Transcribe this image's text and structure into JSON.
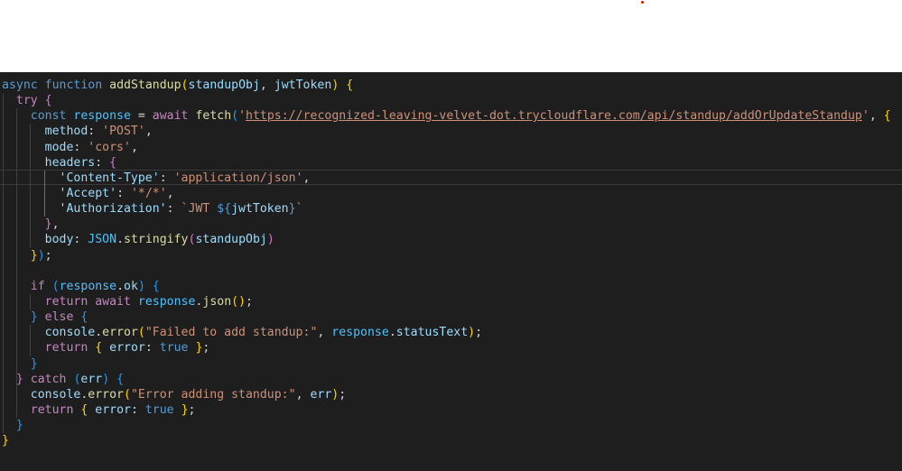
{
  "colors": {
    "editor_bg": "#1e1e1e",
    "page_bg": "#ffffff",
    "indent_guide": "#404040",
    "active_guide": "#707070",
    "marker": "#e51400"
  },
  "code": {
    "lines": [
      [
        {
          "t": "async",
          "c": "kw"
        },
        {
          "t": " "
        },
        {
          "t": "function",
          "c": "kw"
        },
        {
          "t": " "
        },
        {
          "t": "addStandup",
          "c": "fn"
        },
        {
          "t": "(",
          "c": "b1"
        },
        {
          "t": "standupObj",
          "c": "var"
        },
        {
          "t": ", "
        },
        {
          "t": "jwtToken",
          "c": "var"
        },
        {
          "t": ")",
          "c": "b1"
        },
        {
          "t": " "
        },
        {
          "t": "{",
          "c": "b1"
        }
      ],
      [
        {
          "t": "  "
        },
        {
          "t": "try",
          "c": "ctrl"
        },
        {
          "t": " "
        },
        {
          "t": "{",
          "c": "b2"
        }
      ],
      [
        {
          "t": "    "
        },
        {
          "t": "const",
          "c": "kw"
        },
        {
          "t": " "
        },
        {
          "t": "response",
          "c": "const"
        },
        {
          "t": " = "
        },
        {
          "t": "await",
          "c": "ctrl"
        },
        {
          "t": " "
        },
        {
          "t": "fetch",
          "c": "fn"
        },
        {
          "t": "(",
          "c": "b3"
        },
        {
          "t": "'",
          "c": "str"
        },
        {
          "t": "https://recognized-leaving-velvet-dot.trycloudflare.com/api/standup/addOrUpdateStandup",
          "c": "url"
        },
        {
          "t": "'",
          "c": "str"
        },
        {
          "t": ", "
        },
        {
          "t": "{",
          "c": "b1"
        }
      ],
      [
        {
          "t": "      "
        },
        {
          "t": "method",
          "c": "var"
        },
        {
          "t": ": "
        },
        {
          "t": "'POST'",
          "c": "str"
        },
        {
          "t": ","
        }
      ],
      [
        {
          "t": "      "
        },
        {
          "t": "mode",
          "c": "var"
        },
        {
          "t": ": "
        },
        {
          "t": "'cors'",
          "c": "str"
        },
        {
          "t": ","
        }
      ],
      [
        {
          "t": "      "
        },
        {
          "t": "headers",
          "c": "var"
        },
        {
          "t": ": "
        },
        {
          "t": "{",
          "c": "b2"
        }
      ],
      [
        {
          "t": "        "
        },
        {
          "t": "'Content-Type'",
          "c": "var"
        },
        {
          "t": ": "
        },
        {
          "t": "'application/json'",
          "c": "str"
        },
        {
          "t": ","
        }
      ],
      [
        {
          "t": "        "
        },
        {
          "t": "'Accept'",
          "c": "var"
        },
        {
          "t": ": "
        },
        {
          "t": "'*/*'",
          "c": "str"
        },
        {
          "t": ","
        }
      ],
      [
        {
          "t": "        "
        },
        {
          "t": "'Authorization'",
          "c": "var"
        },
        {
          "t": ": "
        },
        {
          "t": "`JWT ",
          "c": "str"
        },
        {
          "t": "${",
          "c": "kw"
        },
        {
          "t": "jwtToken",
          "c": "var"
        },
        {
          "t": "}",
          "c": "kw"
        },
        {
          "t": "`",
          "c": "str"
        }
      ],
      [
        {
          "t": "      "
        },
        {
          "t": "}",
          "c": "b2"
        },
        {
          "t": ","
        }
      ],
      [
        {
          "t": "      "
        },
        {
          "t": "body",
          "c": "var"
        },
        {
          "t": ": "
        },
        {
          "t": "JSON",
          "c": "const"
        },
        {
          "t": "."
        },
        {
          "t": "stringify",
          "c": "fn"
        },
        {
          "t": "(",
          "c": "b2"
        },
        {
          "t": "standupObj",
          "c": "var"
        },
        {
          "t": ")",
          "c": "b2"
        }
      ],
      [
        {
          "t": "    "
        },
        {
          "t": "}",
          "c": "b1"
        },
        {
          "t": ")",
          "c": "b3"
        },
        {
          "t": ";"
        }
      ],
      [],
      [
        {
          "t": "    "
        },
        {
          "t": "if",
          "c": "ctrl"
        },
        {
          "t": " "
        },
        {
          "t": "(",
          "c": "b3"
        },
        {
          "t": "response",
          "c": "const"
        },
        {
          "t": "."
        },
        {
          "t": "ok",
          "c": "var"
        },
        {
          "t": ")",
          "c": "b3"
        },
        {
          "t": " "
        },
        {
          "t": "{",
          "c": "b3"
        }
      ],
      [
        {
          "t": "      "
        },
        {
          "t": "return",
          "c": "ctrl"
        },
        {
          "t": " "
        },
        {
          "t": "await",
          "c": "ctrl"
        },
        {
          "t": " "
        },
        {
          "t": "response",
          "c": "const"
        },
        {
          "t": "."
        },
        {
          "t": "json",
          "c": "fn"
        },
        {
          "t": "(",
          "c": "b1"
        },
        {
          "t": ")",
          "c": "b1"
        },
        {
          "t": ";"
        }
      ],
      [
        {
          "t": "    "
        },
        {
          "t": "}",
          "c": "b3"
        },
        {
          "t": " "
        },
        {
          "t": "else",
          "c": "ctrl"
        },
        {
          "t": " "
        },
        {
          "t": "{",
          "c": "b3"
        }
      ],
      [
        {
          "t": "      "
        },
        {
          "t": "console",
          "c": "var"
        },
        {
          "t": "."
        },
        {
          "t": "error",
          "c": "fn"
        },
        {
          "t": "(",
          "c": "b1"
        },
        {
          "t": "\"Failed to add standup:\"",
          "c": "str"
        },
        {
          "t": ", "
        },
        {
          "t": "response",
          "c": "const"
        },
        {
          "t": "."
        },
        {
          "t": "statusText",
          "c": "var"
        },
        {
          "t": ")",
          "c": "b1"
        },
        {
          "t": ";"
        }
      ],
      [
        {
          "t": "      "
        },
        {
          "t": "return",
          "c": "ctrl"
        },
        {
          "t": " "
        },
        {
          "t": "{",
          "c": "b1"
        },
        {
          "t": " "
        },
        {
          "t": "error",
          "c": "var"
        },
        {
          "t": ": "
        },
        {
          "t": "true",
          "c": "bool"
        },
        {
          "t": " "
        },
        {
          "t": "}",
          "c": "b1"
        },
        {
          "t": ";"
        }
      ],
      [
        {
          "t": "    "
        },
        {
          "t": "}",
          "c": "b3"
        }
      ],
      [
        {
          "t": "  "
        },
        {
          "t": "}",
          "c": "b2"
        },
        {
          "t": " "
        },
        {
          "t": "catch",
          "c": "ctrl"
        },
        {
          "t": " "
        },
        {
          "t": "(",
          "c": "b3"
        },
        {
          "t": "err",
          "c": "var"
        },
        {
          "t": ")",
          "c": "b3"
        },
        {
          "t": " "
        },
        {
          "t": "{",
          "c": "b3"
        }
      ],
      [
        {
          "t": "    "
        },
        {
          "t": "console",
          "c": "var"
        },
        {
          "t": "."
        },
        {
          "t": "error",
          "c": "fn"
        },
        {
          "t": "(",
          "c": "b1"
        },
        {
          "t": "\"Error adding standup:\"",
          "c": "str"
        },
        {
          "t": ", "
        },
        {
          "t": "err",
          "c": "var"
        },
        {
          "t": ")",
          "c": "b1"
        },
        {
          "t": ";"
        }
      ],
      [
        {
          "t": "    "
        },
        {
          "t": "return",
          "c": "ctrl"
        },
        {
          "t": " "
        },
        {
          "t": "{",
          "c": "b1"
        },
        {
          "t": " "
        },
        {
          "t": "error",
          "c": "var"
        },
        {
          "t": ": "
        },
        {
          "t": "true",
          "c": "bool"
        },
        {
          "t": " "
        },
        {
          "t": "}",
          "c": "b1"
        },
        {
          "t": ";"
        }
      ],
      [
        {
          "t": "  "
        },
        {
          "t": "}",
          "c": "b3"
        }
      ],
      [
        {
          "t": "}",
          "c": "b1"
        }
      ]
    ]
  }
}
